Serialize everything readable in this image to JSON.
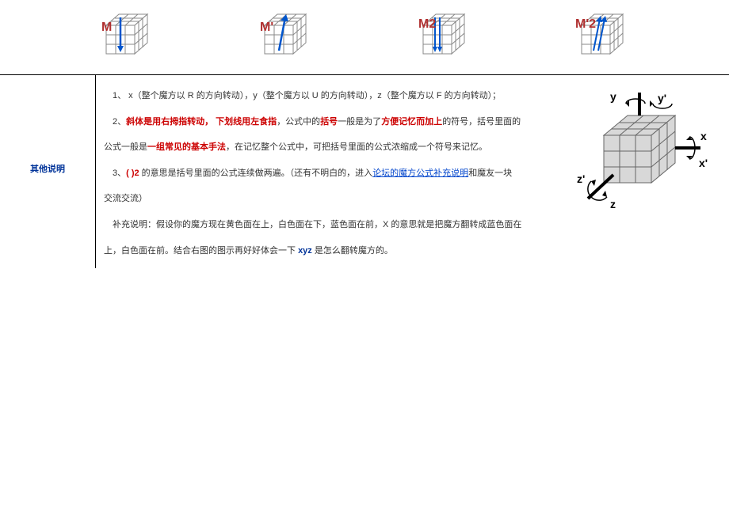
{
  "cubes": [
    {
      "label": "M"
    },
    {
      "label": "M'"
    },
    {
      "label": "M2"
    },
    {
      "label": "M'2"
    }
  ],
  "sidebar": {
    "title": "其他说明"
  },
  "content": {
    "p1_a": "1、 x（整个魔方以 R 的方向转动），y（整个魔方以 U 的方向转动），z（整个魔方以 F 的方向转动）；",
    "p2_a": "2、",
    "p2_b": "斜体是用右拇指转动，  下划线用左食指",
    "p2_c": "，公式中的",
    "p2_d": "括号",
    "p2_e": "一般是为了",
    "p2_f": "方便记忆而加上",
    "p2_g": "的符号，括号里面的",
    "p3_a": "公式一般是",
    "p3_b": "一组常见的基本手法",
    "p3_c": "，在记忆整个公式中，可把括号里面的公式浓缩成一个符号来记忆。",
    "p4_a": "3、",
    "p4_b": "(  )2",
    "p4_c": " 的意思是括号里面的公式连续做两遍。（还有不明白的，进入",
    "p4_d": "论坛的魔方公式补充说明",
    "p4_e": "和魔友一块",
    "p5_a": "交流交流）",
    "p6_a": "补充说明：假设你的魔方现在黄色面在上，白色面在下，蓝色面在前，X 的意思就是把魔方翻转成蓝色面在",
    "p7_a": "上，白色面在前。结合右图的图示再好好体会一下 ",
    "p7_b": "xyz",
    "p7_c": " 是怎么翻转魔方的。"
  },
  "axes": {
    "y": "y",
    "yp": "y'",
    "x": "x",
    "xp": "x'",
    "z": "z",
    "zp": "z'"
  }
}
